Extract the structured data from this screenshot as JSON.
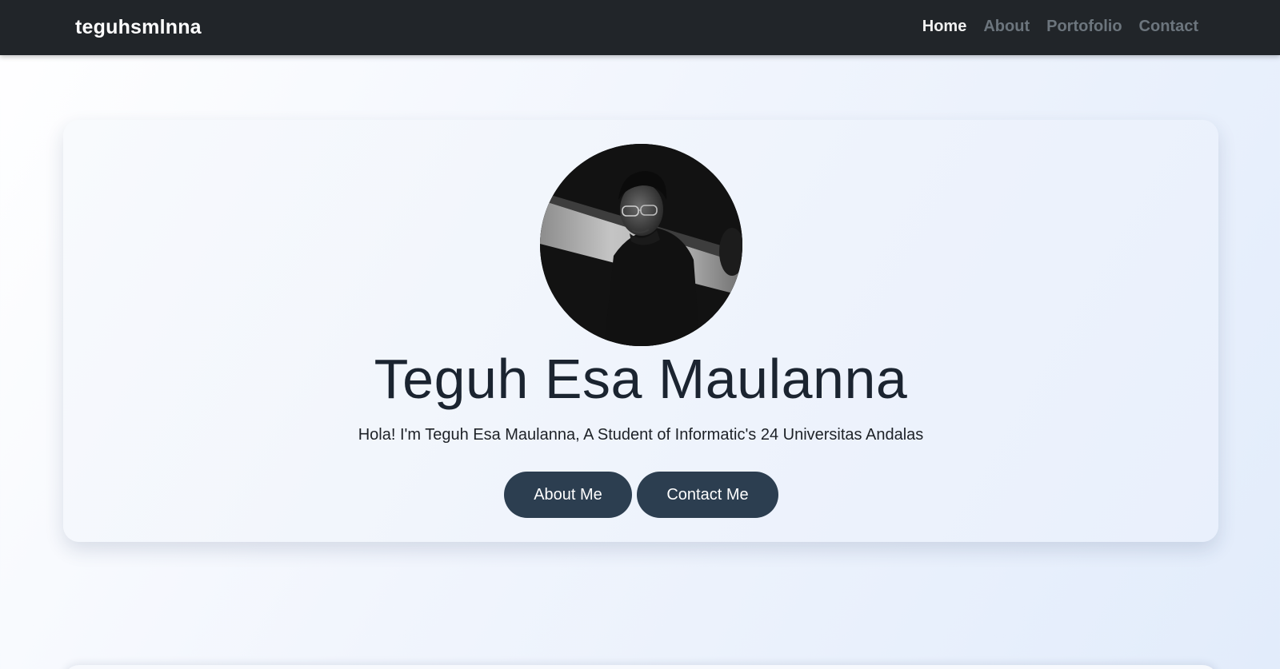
{
  "navbar": {
    "brand": "teguhsmlnna",
    "links": [
      {
        "label": "Home",
        "active": true
      },
      {
        "label": "About",
        "active": false
      },
      {
        "label": "Portofolio",
        "active": false
      },
      {
        "label": "Contact",
        "active": false
      }
    ]
  },
  "hero": {
    "avatar_icon": "profile-photo",
    "name": "Teguh Esa Maulanna",
    "subtitle": "Hola! I'm Teguh Esa Maulanna, A Student of Informatic's 24 Universitas Andalas",
    "buttons": {
      "about": "About Me",
      "contact": "Contact Me"
    }
  },
  "colors": {
    "navbar_bg": "#212529",
    "nav_active": "#f1f1f1",
    "nav_inactive": "#6c757d",
    "button_bg": "#2c3e50",
    "heading_text": "#1b2430"
  }
}
